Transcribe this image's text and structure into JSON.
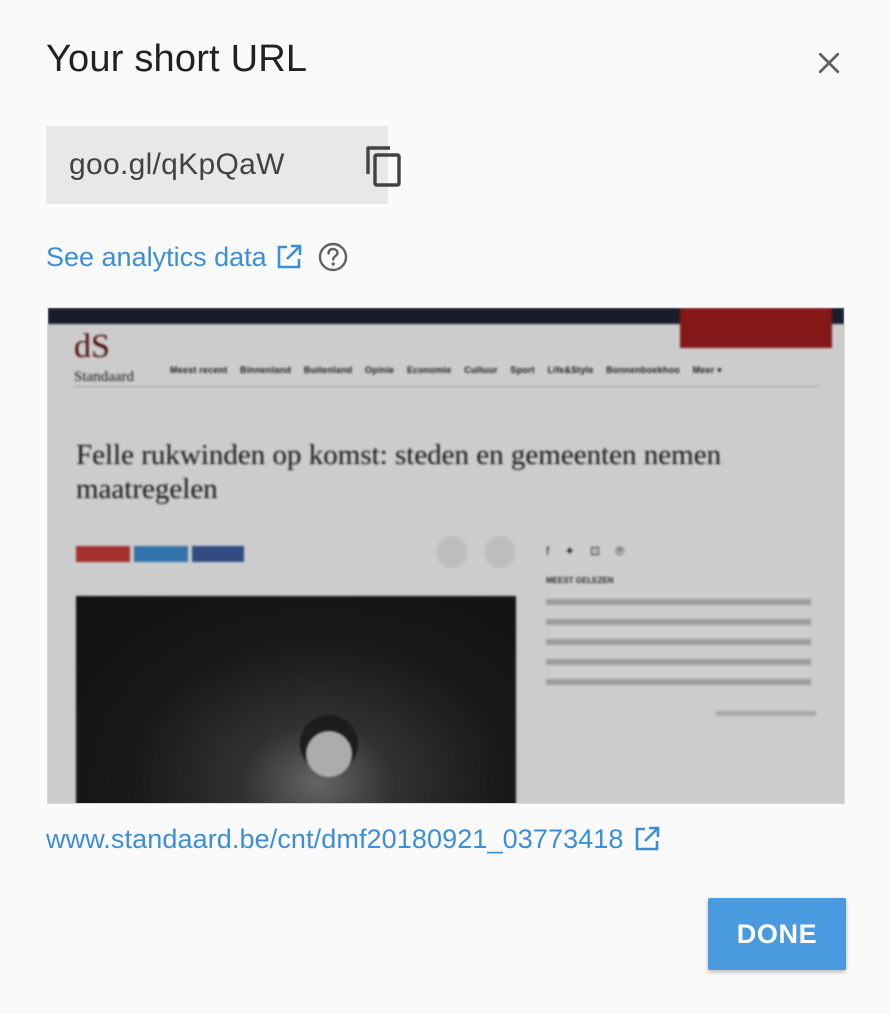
{
  "dialog": {
    "title": "Your short URL",
    "close_icon": "close-icon",
    "short_url": "goo.gl/qKpQaW",
    "copy_icon": "copy-icon",
    "analytics_label": "See analytics data",
    "analytics_icon": "open-in-new-icon",
    "help_icon": "help-icon",
    "destination_url": "www.standaard.be/cnt/dmf20180921_03773418",
    "destination_icon": "open-in-new-icon",
    "done_label": "DONE",
    "accent_color": "#4a9ae0"
  },
  "preview": {
    "logo_mark": "dS",
    "logo_sub": "Standaard",
    "nav": [
      "Meest recent",
      "Binnenland",
      "Buitenland",
      "Opinie",
      "Economie",
      "Cultuur",
      "Sport",
      "Life&Style",
      "Bonnenboekhoo",
      "Meer ▾"
    ],
    "headline": "Felle rukwinden op komst: steden en gemeenten nemen maatregelen",
    "side_icons": "f ✦ ⊡ ℗",
    "side_head": "MEEST GELEZEN"
  }
}
